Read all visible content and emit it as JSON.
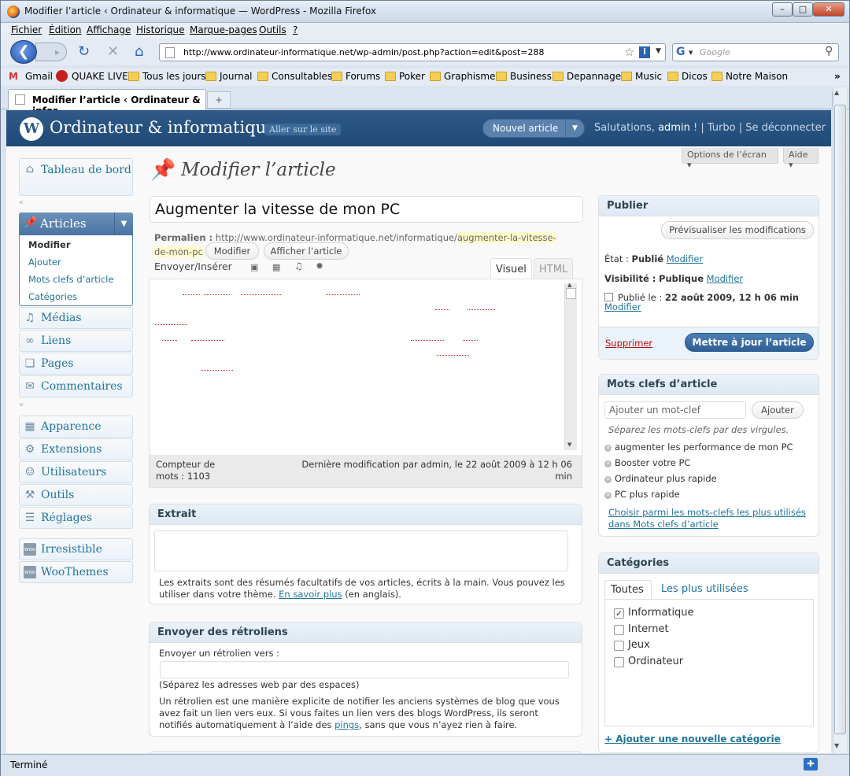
{
  "window": {
    "title": "Modifier l’article ‹ Ordinateur & informatique — WordPress - Mozilla Firefox"
  },
  "menubar": [
    "Fichier",
    "Édition",
    "Affichage",
    "Historique",
    "Marque-pages",
    "Outils",
    "?"
  ],
  "nav": {
    "url": "http://www.ordinateur-informatique.net/wp-admin/post.php?action=edit&post=288",
    "search_placeholder": "Google"
  },
  "bookmarks": [
    "Gmail",
    "QUAKE LIVE",
    "Tous les jours",
    "Journal",
    "Consultables",
    "Forums",
    "Poker",
    "Graphisme",
    "Business",
    "Depannage",
    "Music",
    "Dicos",
    "Notre Maison"
  ],
  "tab": {
    "label": "Modifier l’article ‹ Ordinateur & infor..."
  },
  "wp": {
    "site_name": "Ordinateur & informatique",
    "visit_site": "Aller sur le site",
    "new_post": "Nouvel article",
    "greeting": "Salutations,",
    "user": "admin",
    "greeting_end": "! | Turbo | Se déconnecter",
    "screen_options": "Options de l’écran",
    "help": "Aide"
  },
  "sidebar": {
    "dashboard": "Tableau de bord",
    "articles": "Articles",
    "articles_sub": [
      "Modifier",
      "Ajouter",
      "Mots clefs d’article",
      "Catégories"
    ],
    "items1": [
      "Médias",
      "Liens",
      "Pages",
      "Commentaires"
    ],
    "items2": [
      "Apparence",
      "Extensions",
      "Utilisateurs",
      "Outils",
      "Réglages"
    ],
    "items3": [
      "Irresistible",
      "WooThemes"
    ]
  },
  "page": {
    "heading": "Modifier l’article",
    "post_title": "Augmenter la vitesse de mon PC"
  },
  "permalink": {
    "label": "Permalien :",
    "base": "http://www.ordinateur-informatique.net/informatique/",
    "slug1": "augmenter-la-vitesse-",
    "slug2": "de-mon-pc",
    "edit": "Modifier",
    "view": "Afficher l’article"
  },
  "editor": {
    "upload": "Envoyer/Insérer",
    "visual": "Visuel",
    "html": "HTML",
    "word_count": "Compteur de mots : 1103",
    "word_count_1": "Compteur de",
    "word_count_2": "mots : 1103",
    "last_edit_1": "Dernière modification par admin, le 22 août 2009 à 12 h 06",
    "last_edit_2": "min"
  },
  "excerpt": {
    "title": "Extrait",
    "help_1": "Les extraits sont des résumés facultatifs de vos articles, écrits à la main. Vous pouvez les",
    "help_2": "utiliser dans votre thème.",
    "link": "En savoir plus",
    "help_3": "(en anglais)."
  },
  "trackbacks": {
    "title": "Envoyer des rétroliens",
    "label": "Envoyer un rétrolien vers :",
    "hint": "(Séparez les adresses web par des espaces)",
    "p1": "Un rétrolien est une manière explicite de notifier les anciens systèmes de blog que vous",
    "p2": "avez fait un lien vers eux. Si vous faites un lien vers des blogs WordPress, ils seront",
    "p3": "notifiés automatiquement à l’aide des",
    "pings": "pings",
    "p4": ", sans que vous n’ayez rien à faire."
  },
  "publish": {
    "title": "Publier",
    "preview": "Prévisualiser les modifications",
    "status_label": "État :",
    "status": "Publié",
    "modify": "Modifier",
    "vis_label": "Visibilité :",
    "visibility": "Publique",
    "date_label": "Publié le :",
    "date": "22 août 2009, 12 h 06 min",
    "delete": "Supprimer",
    "update": "Mettre à jour l’article"
  },
  "tags": {
    "title": "Mots clefs d’article",
    "placeholder": "Ajouter un mot-clef",
    "add": "Ajouter",
    "hint": "Séparez les mots-clefs par des virgules.",
    "list": [
      "augmenter les performance de mon PC",
      "Booster votre PC",
      "Ordinateur plus rapide",
      "PC plus rapide"
    ],
    "choose_1": "Choisir parmi les mots-clefs les plus utilisés",
    "choose_2": "dans Mots clefs d’article"
  },
  "categories": {
    "title": "Catégories",
    "tab_all": "Toutes",
    "tab_popular": "Les plus utilisées",
    "list": [
      {
        "name": "Informatique",
        "checked": true
      },
      {
        "name": "Internet",
        "checked": false
      },
      {
        "name": "Jeux",
        "checked": false
      },
      {
        "name": "Ordinateur",
        "checked": false
      }
    ],
    "add": "+ Ajouter une nouvelle catégorie"
  },
  "statusbar": {
    "text": "Terminé"
  }
}
